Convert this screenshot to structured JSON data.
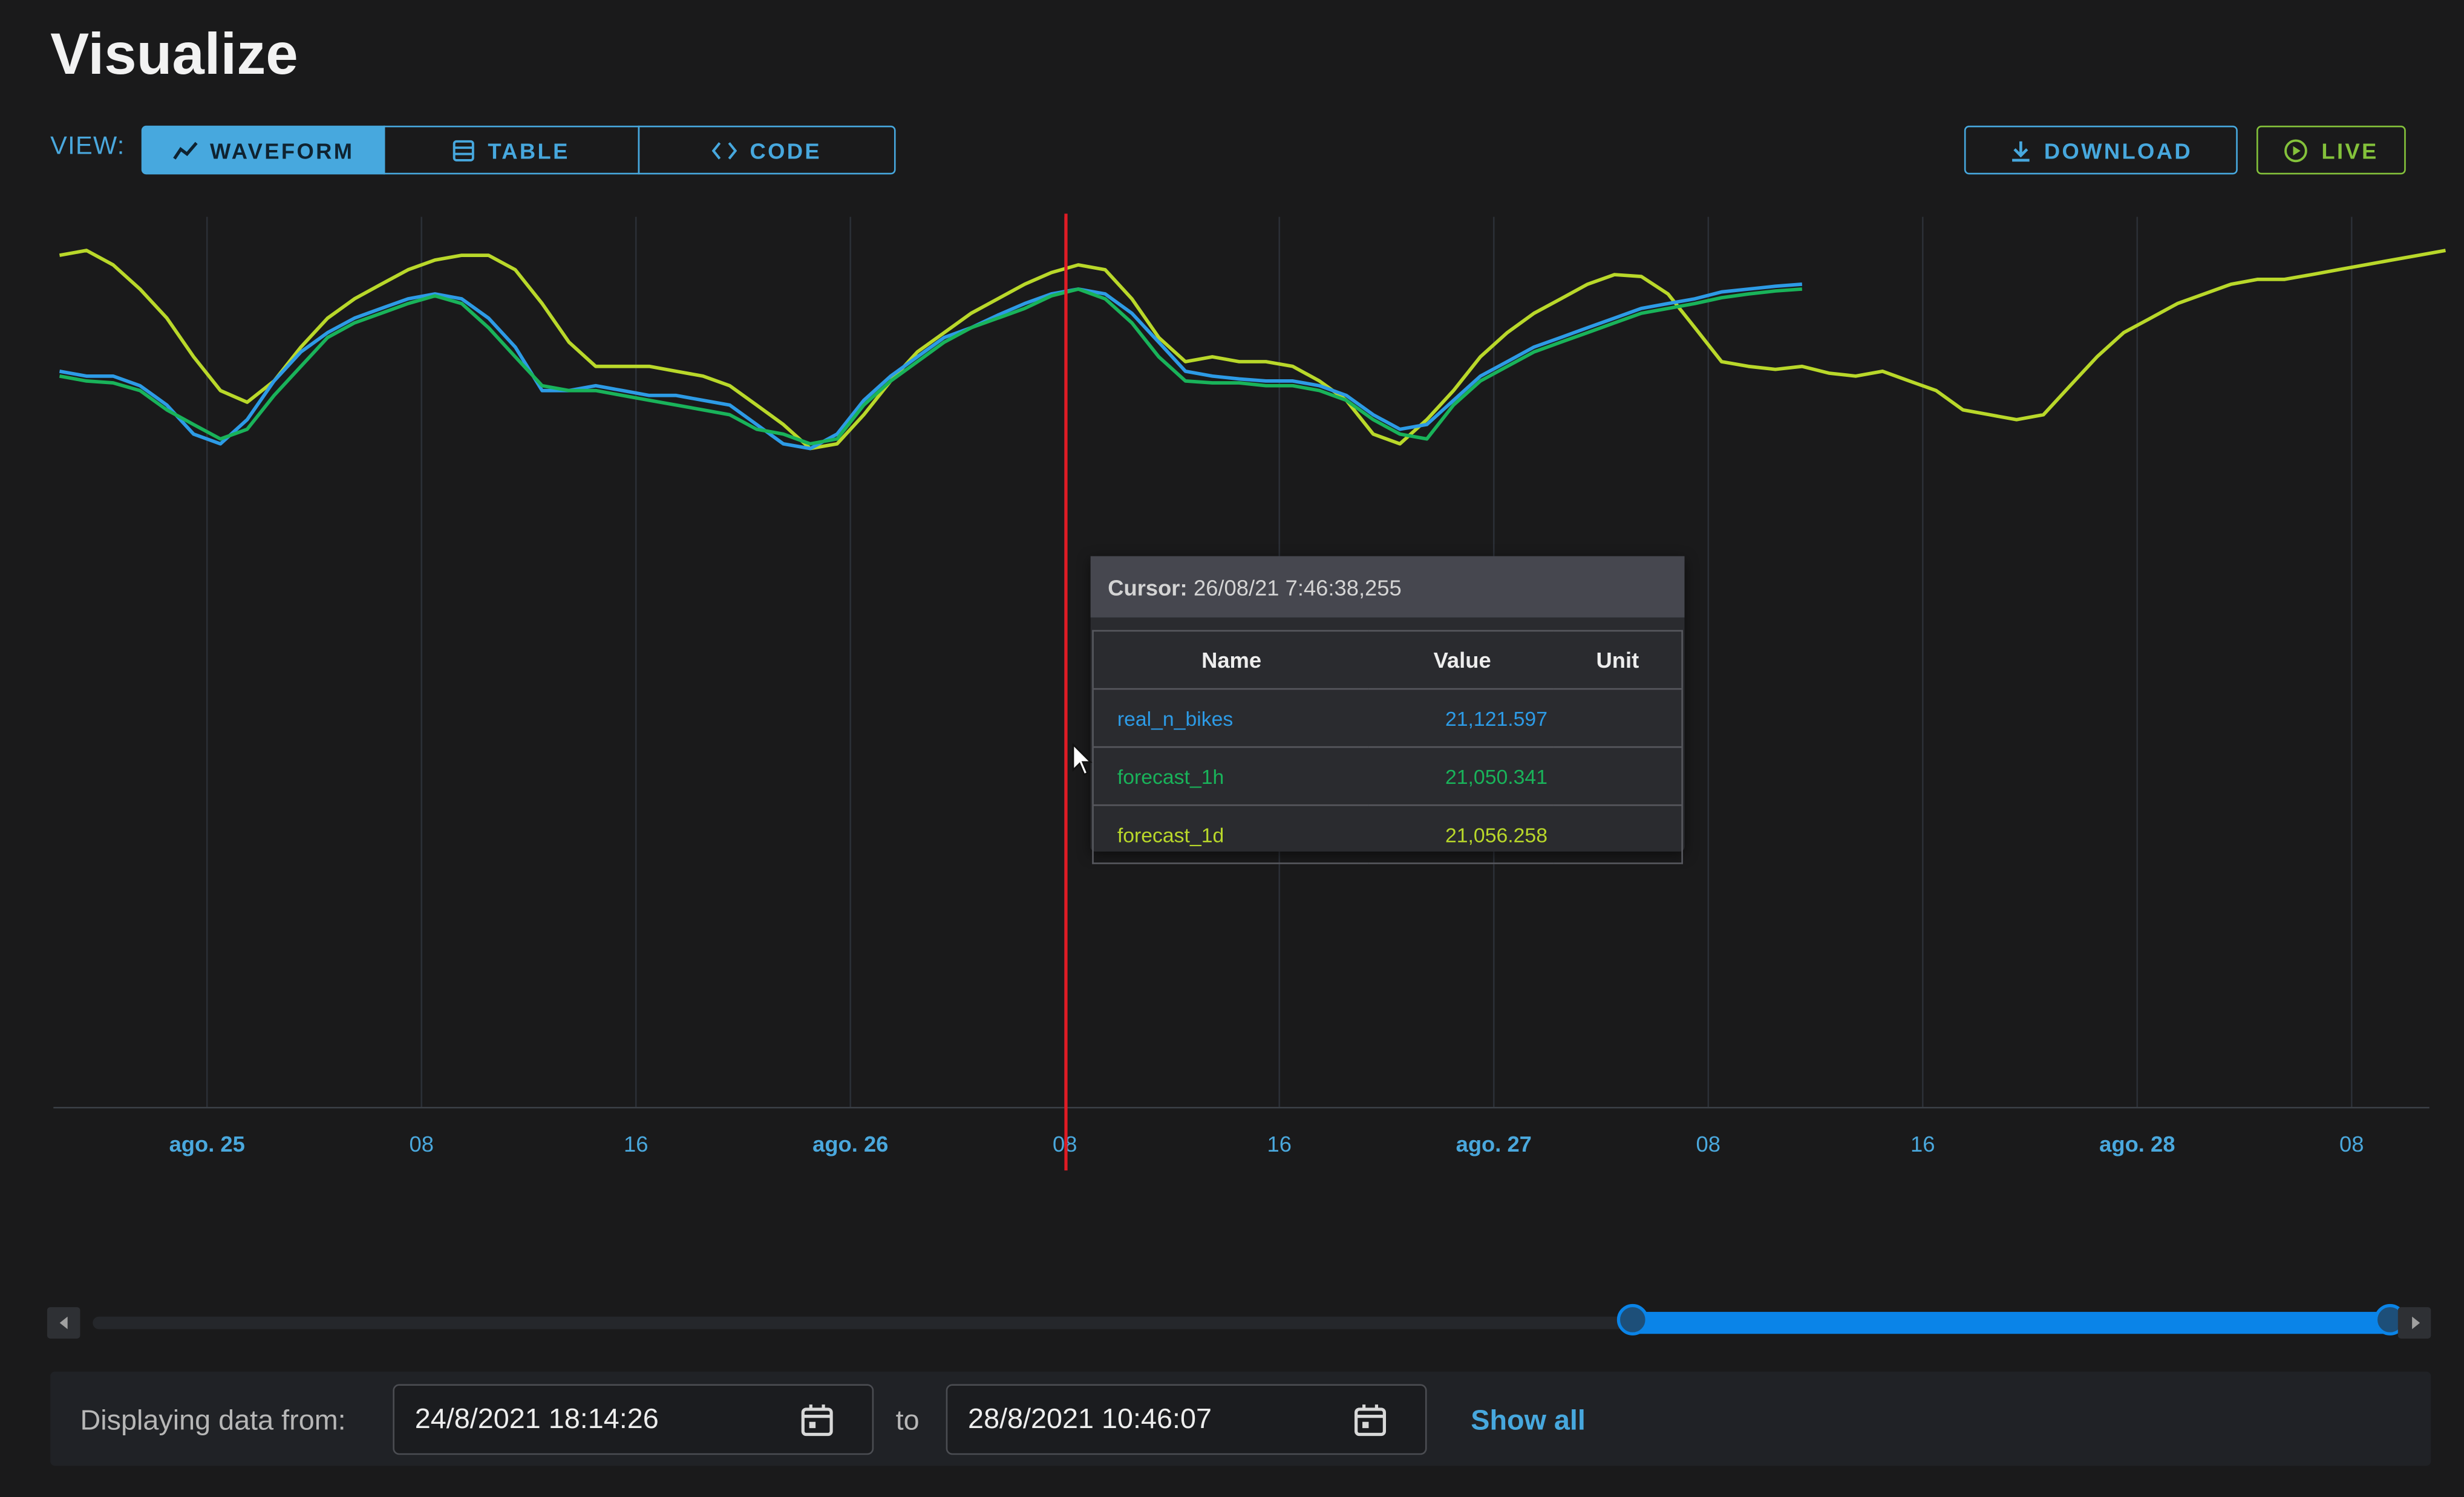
{
  "page": {
    "title": "Visualize"
  },
  "view": {
    "label": "VIEW:",
    "tabs": [
      {
        "label": "WAVEFORM",
        "icon": "chart-line-icon",
        "selected": true
      },
      {
        "label": "TABLE",
        "icon": "table-icon",
        "selected": false
      },
      {
        "label": "CODE",
        "icon": "code-icon",
        "selected": false
      }
    ]
  },
  "actions": {
    "download_label": "DOWNLOAD",
    "live_label": "LIVE"
  },
  "colors": {
    "accent": "#47a8de",
    "live": "#84c23b",
    "cursor": "#e01b24",
    "real_n_bikes": "#2d9be6",
    "forecast_1h": "#19b35a",
    "forecast_1d": "#b9d82a"
  },
  "chart_data": {
    "type": "line",
    "x_ticks": [
      "ago. 25",
      "08",
      "16",
      "ago. 26",
      "08",
      "16",
      "ago. 27",
      "08",
      "16",
      "ago. 28",
      "08"
    ],
    "x_range": [
      "2021-08-24 18:14:26",
      "2021-08-28 10:46:07"
    ],
    "y_axis_labels": "none shown",
    "grid": "vertical lines only",
    "legend": "none",
    "series": [
      {
        "name": "forecast_1d",
        "x_hours": [
          0,
          1,
          2,
          3,
          4,
          5,
          6,
          7,
          8,
          9,
          10,
          11,
          12,
          13,
          14,
          15,
          16,
          17,
          18,
          19,
          20,
          21,
          22,
          23,
          24,
          25,
          26,
          27,
          28,
          29,
          30,
          31,
          32,
          33,
          34,
          35,
          36,
          37,
          38,
          39,
          40,
          41,
          42,
          43,
          44,
          45,
          46,
          47,
          48,
          49,
          50,
          51,
          52,
          53,
          54,
          55,
          56,
          57,
          58,
          59,
          60,
          61,
          62,
          63,
          64,
          65,
          66,
          67,
          68,
          69,
          70,
          71,
          72,
          73,
          74,
          75,
          76,
          77,
          78,
          79,
          80,
          81,
          82,
          83,
          84,
          85,
          86,
          87,
          88,
          89
        ],
        "values": [
          22700,
          22750,
          22600,
          22350,
          22050,
          21650,
          21300,
          21180,
          21400,
          21750,
          22050,
          22250,
          22400,
          22550,
          22650,
          22700,
          22700,
          22550,
          22200,
          21800,
          21550,
          21550,
          21550,
          21500,
          21450,
          21350,
          21150,
          20950,
          20700,
          20750,
          21050,
          21400,
          21700,
          21900,
          22100,
          22250,
          22400,
          22520,
          22600,
          22550,
          22250,
          21850,
          21600,
          21650,
          21600,
          21600,
          21550,
          21400,
          21200,
          20850,
          20750,
          21000,
          21300,
          21650,
          21900,
          22100,
          22250,
          22400,
          22500,
          22480,
          22300,
          21950,
          21600,
          21550,
          21520,
          21550,
          21480,
          21450,
          21500,
          21400,
          21300,
          21100,
          21050,
          21000,
          21050,
          21350,
          21650,
          21900,
          22050,
          22200,
          22300,
          22400,
          22450,
          22450,
          22500,
          22550,
          22600,
          22650,
          22700,
          22750
        ]
      },
      {
        "name": "real_n_bikes",
        "x_hours": [
          0,
          1,
          2,
          3,
          4,
          5,
          6,
          7,
          8,
          9,
          10,
          11,
          12,
          13,
          14,
          15,
          16,
          17,
          18,
          19,
          20,
          21,
          22,
          23,
          24,
          25,
          26,
          27,
          28,
          29,
          30,
          31,
          32,
          33,
          34,
          35,
          36,
          37,
          38,
          39,
          40,
          41,
          42,
          43,
          44,
          45,
          46,
          47,
          48,
          49,
          50,
          51,
          52,
          53,
          54,
          55,
          56,
          57,
          58,
          59,
          60,
          61,
          62,
          63,
          64,
          65
        ],
        "values": [
          21500,
          21450,
          21450,
          21350,
          21150,
          20850,
          20750,
          21000,
          21400,
          21700,
          21900,
          22050,
          22150,
          22250,
          22300,
          22250,
          22050,
          21750,
          21300,
          21300,
          21350,
          21300,
          21250,
          21250,
          21200,
          21150,
          20950,
          20750,
          20700,
          20850,
          21200,
          21450,
          21650,
          21850,
          21950,
          22080,
          22200,
          22300,
          22350,
          22300,
          22100,
          21800,
          21500,
          21450,
          21420,
          21400,
          21400,
          21350,
          21250,
          21050,
          20900,
          20950,
          21200,
          21450,
          21600,
          21750,
          21850,
          21950,
          22050,
          22150,
          22200,
          22250,
          22320,
          22350,
          22380,
          22400
        ]
      },
      {
        "name": "forecast_1h",
        "x_hours": [
          0,
          1,
          2,
          3,
          4,
          5,
          6,
          7,
          8,
          9,
          10,
          11,
          12,
          13,
          14,
          15,
          16,
          17,
          18,
          19,
          20,
          21,
          22,
          23,
          24,
          25,
          26,
          27,
          28,
          29,
          30,
          31,
          32,
          33,
          34,
          35,
          36,
          37,
          38,
          39,
          40,
          41,
          42,
          43,
          44,
          45,
          46,
          47,
          48,
          49,
          50,
          51,
          52,
          53,
          54,
          55,
          56,
          57,
          58,
          59,
          60,
          61,
          62,
          63,
          64,
          65
        ],
        "values": [
          21450,
          21400,
          21380,
          21300,
          21100,
          20950,
          20800,
          20900,
          21250,
          21550,
          21850,
          22000,
          22100,
          22200,
          22280,
          22200,
          21950,
          21650,
          21350,
          21300,
          21300,
          21250,
          21200,
          21150,
          21100,
          21050,
          20900,
          20850,
          20750,
          20800,
          21150,
          21400,
          21600,
          21800,
          21950,
          22050,
          22150,
          22280,
          22350,
          22250,
          22000,
          21650,
          21400,
          21380,
          21380,
          21350,
          21350,
          21300,
          21200,
          21000,
          20850,
          20800,
          21150,
          21400,
          21550,
          21700,
          21800,
          21900,
          22000,
          22100,
          22150,
          22200,
          22260,
          22300,
          22330,
          22350
        ]
      }
    ]
  },
  "cursor": {
    "label": "Cursor:",
    "value": "26/08/21 7:46:38,255",
    "position_hours": 37.54,
    "columns": [
      "Name",
      "Value",
      "Unit"
    ],
    "rows": [
      {
        "name": "real_n_bikes",
        "value": "21,121.597",
        "unit": ""
      },
      {
        "name": "forecast_1h",
        "value": "21,050.341",
        "unit": ""
      },
      {
        "name": "forecast_1d",
        "value": "21,056.258",
        "unit": ""
      }
    ]
  },
  "range": {
    "label": "Displaying data from:",
    "from": "24/8/2021 18:14:26",
    "to_label": "to",
    "to": "28/8/2021 10:46:07",
    "show_all_label": "Show all",
    "scroll_window": {
      "start_fraction": 0.665,
      "end_fraction": 0.992
    }
  }
}
